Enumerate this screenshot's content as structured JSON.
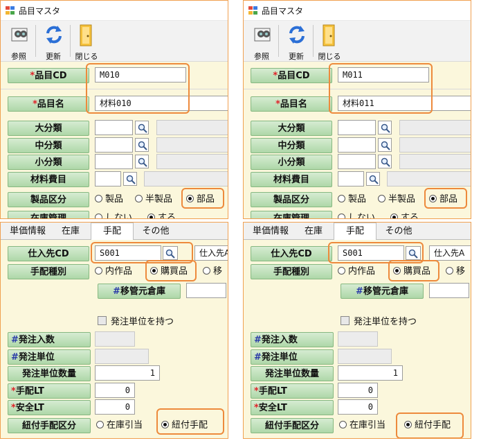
{
  "window": {
    "title": "品目マスタ"
  },
  "toolbar": {
    "browse": "参照",
    "refresh": "更新",
    "close": "閉じる"
  },
  "labels": {
    "item_cd": "品目CD",
    "item_name": "品目名",
    "major": "大分類",
    "middle": "中分類",
    "minor": "小分類",
    "material_cost": "材料費目",
    "product_type": "製品区分",
    "stock_mgmt": "在庫管理",
    "supplier_cd": "仕入先CD",
    "arrange_type": "手配種別",
    "transfer_from": "移管元倉庫",
    "order_units": "発注入数",
    "order_unit": "発注単位",
    "order_unit_qty": "発注単位数量",
    "arrange_lt": "手配LT",
    "safety_lt": "安全LT",
    "linked_arrange": "紐付手配区分"
  },
  "radio": {
    "product": "製品",
    "semi": "半製品",
    "part": "部品",
    "no": "しない",
    "yes": "する",
    "inhouse": "内作品",
    "purchase": "購買品",
    "transfer_partial": "移",
    "stock_alloc": "在庫引当",
    "linked": "紐付手配"
  },
  "tabs": [
    "単価情報",
    "在庫",
    "手配",
    "その他"
  ],
  "checkbox": {
    "has_order_unit": "発注単位を持つ"
  },
  "left": {
    "item_cd": "M010",
    "item_name": "材料010",
    "supplier_cd": "S001",
    "supplier_name": "仕入先A",
    "order_unit_qty": "1",
    "arrange_lt": "0",
    "safety_lt": "0"
  },
  "right": {
    "item_cd": "M011",
    "item_name": "材料011",
    "supplier_cd": "S001",
    "supplier_name": "仕入先A",
    "order_unit_qty": "1",
    "arrange_lt": "0",
    "safety_lt": "0"
  },
  "colors": {
    "highlight": "#ed8a3c",
    "label_green": "#aed7a8",
    "required_star": "#e0242a",
    "hash_blue": "#2a3aa8",
    "panel_bg": "#fbf7dc"
  }
}
